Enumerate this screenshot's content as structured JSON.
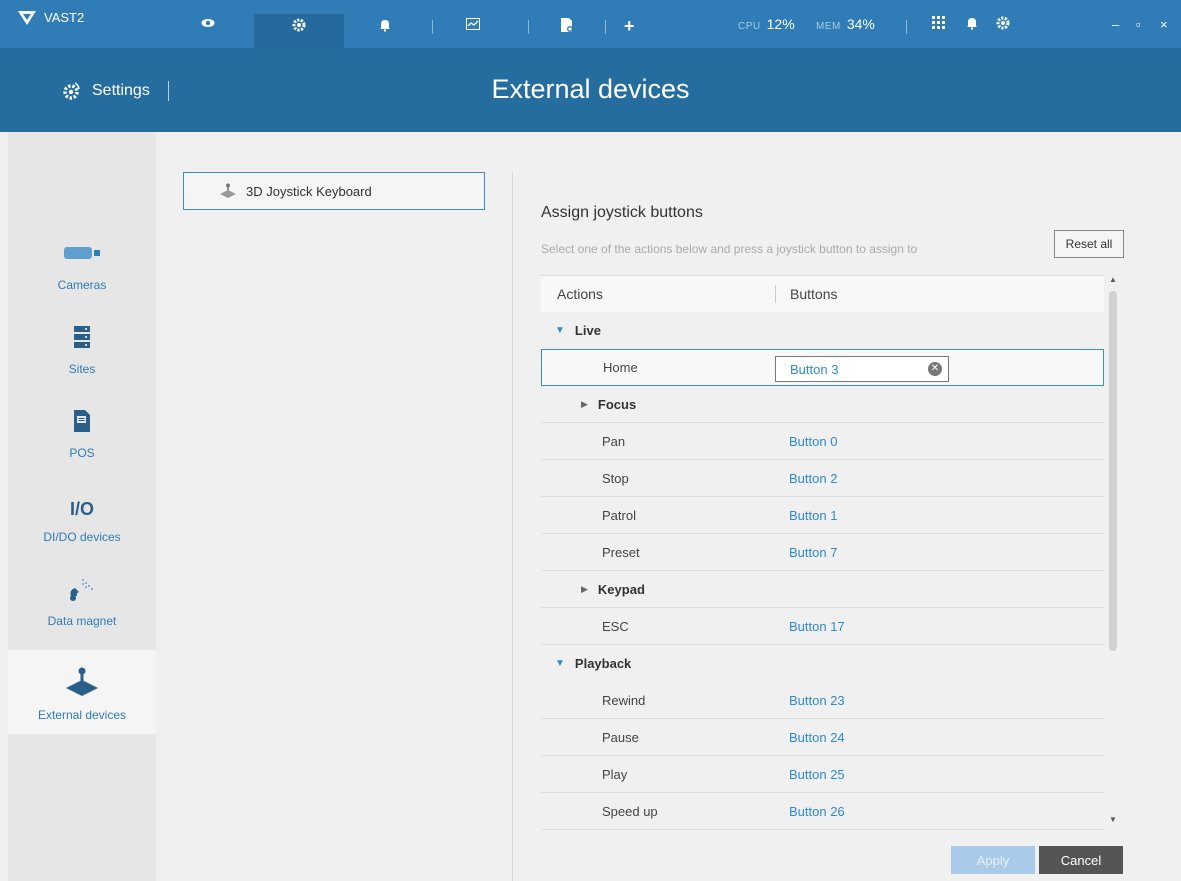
{
  "app": {
    "name": "VAST2"
  },
  "topbar": {
    "cpu_label": "CPU",
    "cpu_value": "12%",
    "mem_label": "MEM",
    "mem_value": "34%",
    "plus": "+",
    "minimize": "–",
    "maximize": "▫",
    "close": "×"
  },
  "header": {
    "section": "Settings",
    "title": "External devices"
  },
  "sidebar": {
    "items": [
      {
        "label": "Cameras",
        "icon": "camera-icon"
      },
      {
        "label": "Sites",
        "icon": "server-icon"
      },
      {
        "label": "POS",
        "icon": "receipt-icon"
      },
      {
        "label": "DI/DO devices",
        "icon_text": "I/O"
      },
      {
        "label": "Data magnet",
        "icon": "magnet-icon"
      },
      {
        "label": "External devices",
        "icon": "joystick-icon",
        "active": true
      }
    ]
  },
  "device": {
    "name": "3D Joystick Keyboard"
  },
  "assign": {
    "title": "Assign joystick buttons",
    "subtitle": "Select one of the actions below and press a joystick button to assign to",
    "reset_label": "Reset all"
  },
  "table": {
    "col_actions": "Actions",
    "col_buttons": "Buttons",
    "rows": [
      {
        "type": "group",
        "label": "Live",
        "expanded": true
      },
      {
        "type": "item",
        "label": "Home",
        "button": "Button 3",
        "selected": true
      },
      {
        "type": "sub",
        "label": "Focus",
        "expanded": false
      },
      {
        "type": "item",
        "label": "Pan",
        "button": "Button 0"
      },
      {
        "type": "item",
        "label": "Stop",
        "button": "Button 2"
      },
      {
        "type": "item",
        "label": "Patrol",
        "button": "Button 1"
      },
      {
        "type": "item",
        "label": "Preset",
        "button": "Button 7"
      },
      {
        "type": "sub",
        "label": "Keypad",
        "expanded": false
      },
      {
        "type": "item",
        "label": "ESC",
        "button": "Button 17"
      },
      {
        "type": "group",
        "label": "Playback",
        "expanded": true
      },
      {
        "type": "item",
        "label": "Rewind",
        "button": "Button 23"
      },
      {
        "type": "item",
        "label": "Pause",
        "button": "Button 24"
      },
      {
        "type": "item",
        "label": "Play",
        "button": "Button 25"
      },
      {
        "type": "item",
        "label": "Speed up",
        "button": "Button 26"
      }
    ]
  },
  "footer": {
    "apply_label": "Apply",
    "cancel_label": "Cancel"
  },
  "colors": {
    "topbar": "#2f7cb7",
    "header": "#256d9f",
    "accent": "#2f8ad0",
    "sidebar": "#e6e6e6"
  }
}
